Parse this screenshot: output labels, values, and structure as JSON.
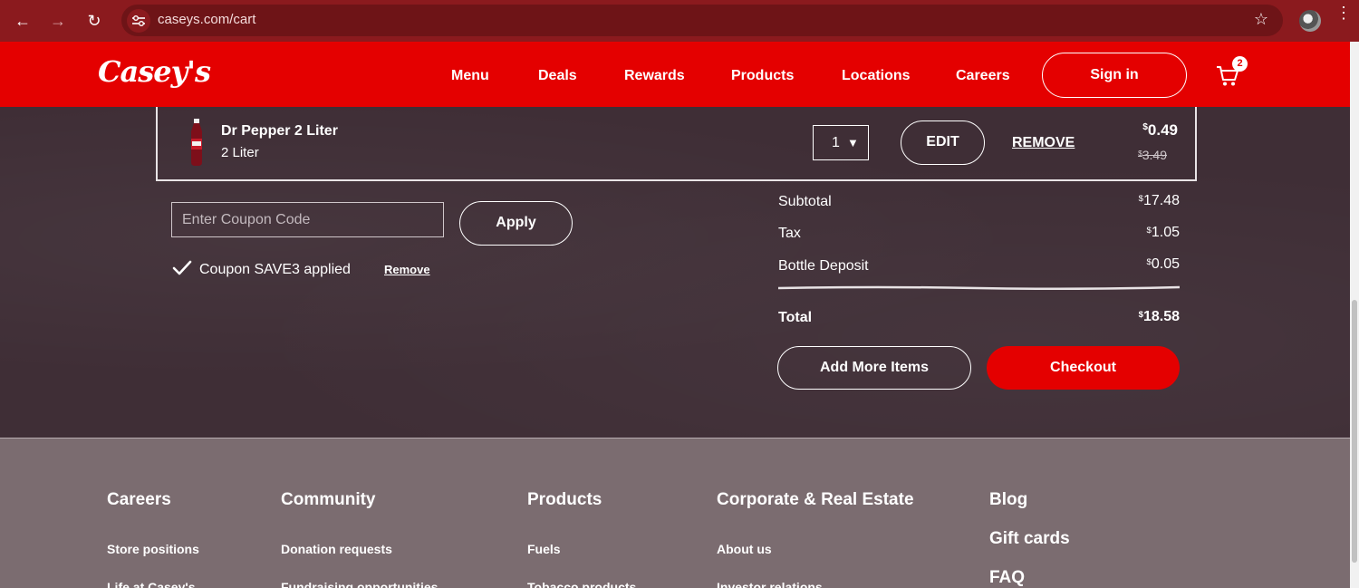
{
  "browser": {
    "url": "caseys.com/cart",
    "back_icon": "←",
    "forward_icon": "→",
    "reload_icon": "↻",
    "star_icon": "☆",
    "menu_icon": "⋮"
  },
  "header": {
    "logo": "Casey's",
    "nav": [
      "Menu",
      "Deals",
      "Rewards",
      "Products",
      "Locations",
      "Careers"
    ],
    "signin_label": "Sign in",
    "cart_count": "2",
    "brand_color": "#e40000"
  },
  "cart_item": {
    "name": "Dr Pepper 2 Liter",
    "size": "2 Liter",
    "quantity": "1",
    "edit_label": "EDIT",
    "remove_label": "REMOVE",
    "price_now_symbol": "$",
    "price_now": "0.49",
    "price_was_symbol": "$",
    "price_was": "3.49"
  },
  "coupon": {
    "placeholder": "Enter Coupon Code",
    "apply_label": "Apply",
    "applied_text": "Coupon SAVE3 applied",
    "remove_label": "Remove"
  },
  "summary": {
    "rows": [
      {
        "label": "Subtotal",
        "symbol": "$",
        "value": "17.48"
      },
      {
        "label": "Tax",
        "symbol": "$",
        "value": "1.05"
      },
      {
        "label": "Bottle Deposit",
        "symbol": "$",
        "value": "0.05"
      }
    ],
    "total_label": "Total",
    "total_symbol": "$",
    "total_value": "18.58",
    "add_more_label": "Add More Items",
    "checkout_label": "Checkout"
  },
  "footer": {
    "columns": [
      {
        "heading": "Careers",
        "links": [
          "Store positions",
          "Life at Casey's"
        ]
      },
      {
        "heading": "Community",
        "links": [
          "Donation requests",
          "Fundraising opportunities"
        ]
      },
      {
        "heading": "Products",
        "links": [
          "Fuels",
          "Tobacco products"
        ]
      },
      {
        "heading": "Corporate & Real Estate",
        "links": [
          "About us",
          "Investor relations"
        ]
      }
    ],
    "extra_headings": [
      "Blog",
      "Gift cards",
      "FAQ"
    ]
  }
}
